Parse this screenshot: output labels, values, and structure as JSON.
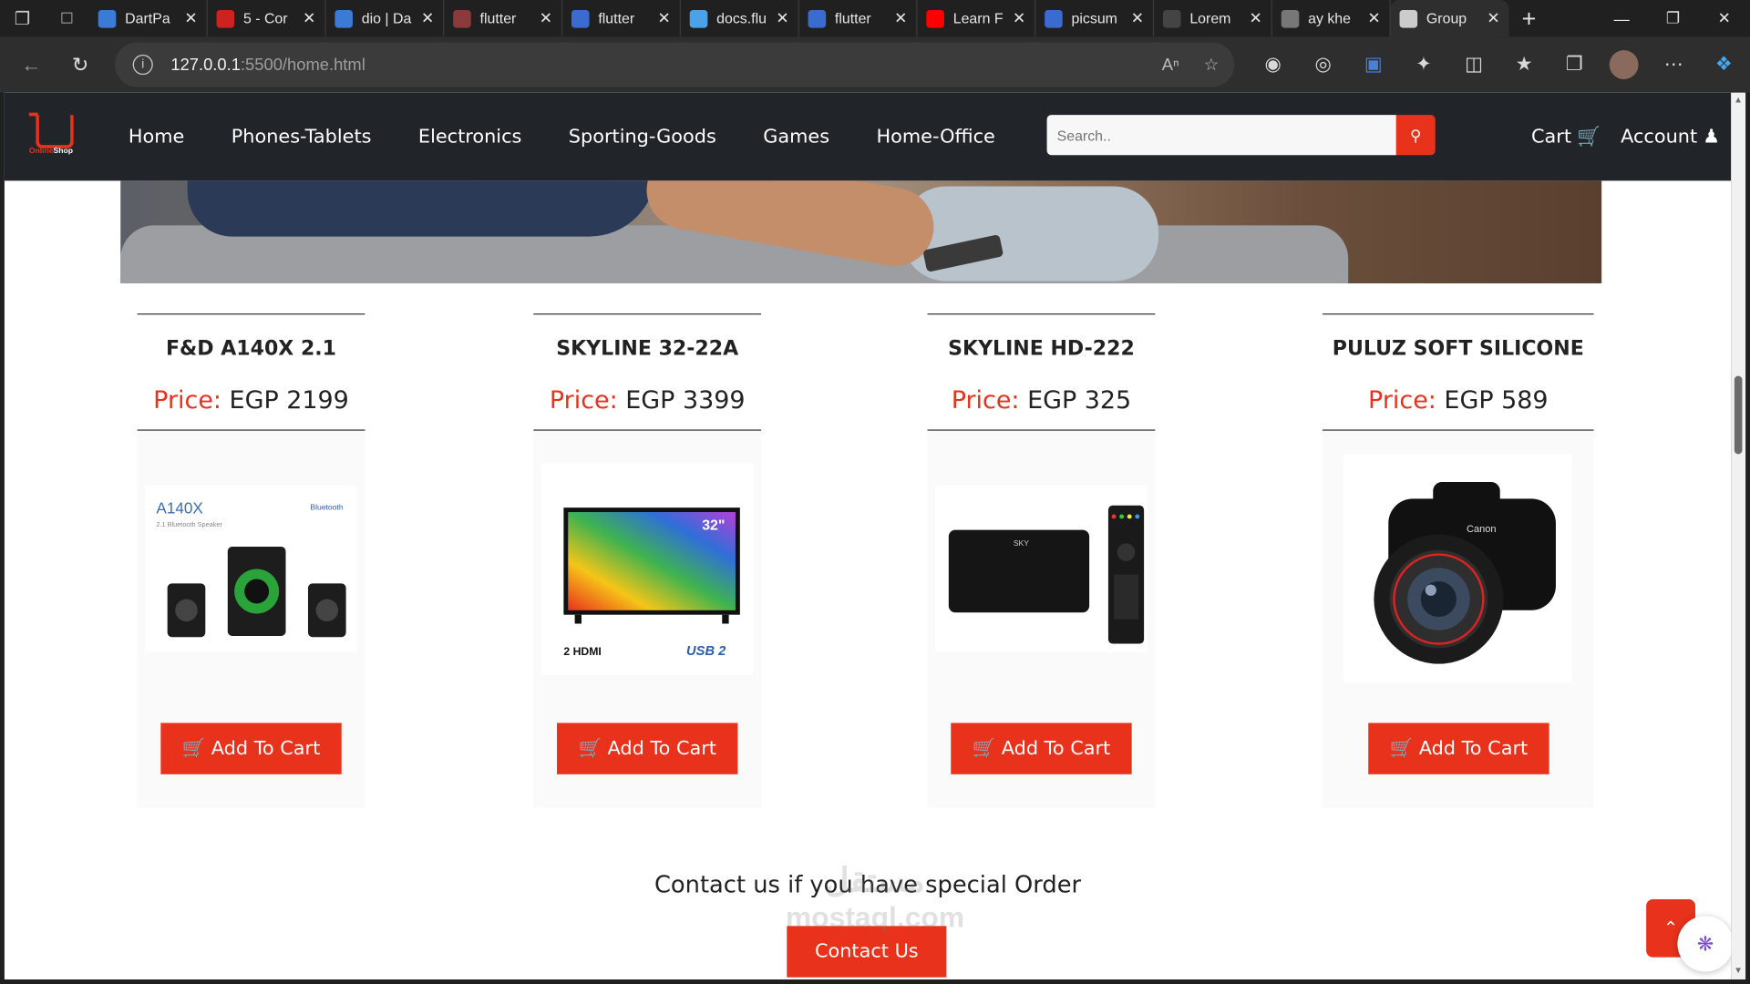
{
  "tabs": [
    {
      "label": "DartPa",
      "color": "#3b7bd6"
    },
    {
      "label": "5 - Cor",
      "color": "#cc2222"
    },
    {
      "label": "dio | Da",
      "color": "#3b7bd6"
    },
    {
      "label": "flutter",
      "color": "#8a3a3a"
    },
    {
      "label": "flutter",
      "color": "#3a6bd1"
    },
    {
      "label": "docs.flu",
      "color": "#4aa3e8"
    },
    {
      "label": "flutter",
      "color": "#3a6bd1"
    },
    {
      "label": "Learn F",
      "color": "#ff0000"
    },
    {
      "label": "picsum",
      "color": "#3a6bd1"
    },
    {
      "label": "Lorem",
      "color": "#444444"
    },
    {
      "label": "ay khe",
      "color": "#777777"
    },
    {
      "label": "Group",
      "color": "#cccccc"
    }
  ],
  "address": {
    "host": "127.0.0.1",
    "path": ":5500/home.html"
  },
  "site": {
    "brand_a": "Online",
    "brand_b": "Shop",
    "nav": [
      "Home",
      "Phones-Tablets",
      "Electronics",
      "Sporting-Goods",
      "Games",
      "Home-Office"
    ],
    "search_placeholder": "Search..",
    "cart_label": "Cart",
    "account_label": "Account"
  },
  "products": [
    {
      "title": "F&D A140X 2.1",
      "price_label": "Price:",
      "price": "EGP 2199",
      "button": "Add To Cart",
      "image_label": "A140X",
      "image_sub": "2.1 Bluetooth Speaker",
      "image_badge": "Bluetooth"
    },
    {
      "title": "SKYLINE 32-22A",
      "price_label": "Price:",
      "price": "EGP 3399",
      "button": "Add To Cart",
      "image_label": "32\"",
      "image_sub": "2 HDMI",
      "image_badge": "USB 2"
    },
    {
      "title": "SKYLINE HD-222",
      "price_label": "Price:",
      "price": "EGP 325",
      "button": "Add To Cart",
      "image_label": "SKY",
      "image_sub": "",
      "image_badge": ""
    },
    {
      "title": "PULUZ SOFT SILICONE",
      "price_label": "Price:",
      "price": "EGP 589",
      "button": "Add To Cart",
      "image_label": "Canon",
      "image_sub": "",
      "image_badge": ""
    }
  ],
  "contact": {
    "text": "Contact us if you have special Order",
    "button": "Contact Us"
  },
  "watermark": {
    "line1": "مستقل",
    "line2": "mostaql.com"
  },
  "colors": {
    "accent": "#e8321b",
    "header_bg": "#212529"
  }
}
